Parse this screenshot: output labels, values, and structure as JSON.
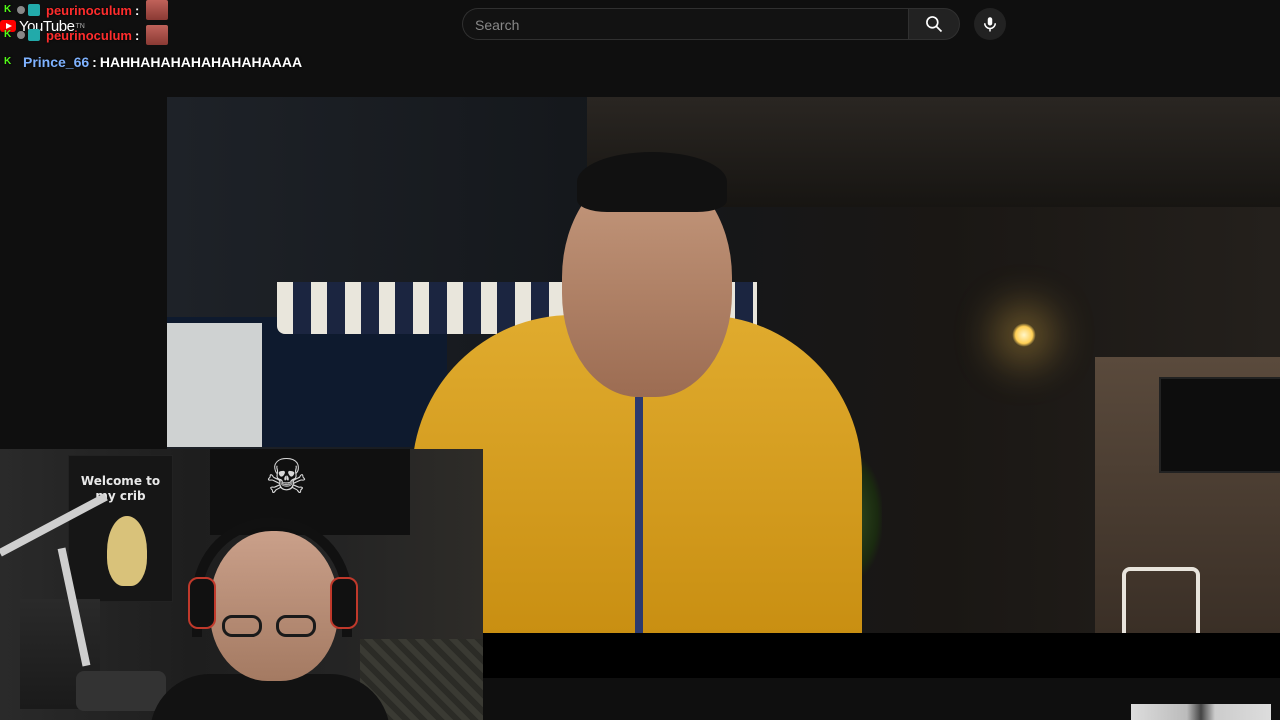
{
  "header": {
    "logo_text": "YouTube",
    "logo_superscript": "TN",
    "search_placeholder": "Search",
    "search_icon": "search-icon",
    "mic_icon": "mic-icon"
  },
  "chat": {
    "messages": [
      {
        "user": "peurinoculum",
        "separator": ":",
        "text": "",
        "user_color": "#ff2d2d",
        "emote": true
      },
      {
        "user": "peurinoculum",
        "separator": ":",
        "text": "",
        "user_color": "#ff2d2d",
        "emote": true
      },
      {
        "user": "Prince_66",
        "separator": ":",
        "text": "HAHHAHAHAHAHAHAHAAAA",
        "user_color": "#7fb2ff",
        "emote": false
      }
    ],
    "badge_glyph": "K",
    "badge_color": "#53fc18"
  },
  "webcam": {
    "banner_text": "Welcome to my crib",
    "skull_glyph": "☠"
  },
  "colors": {
    "background": "#0f0f0f",
    "accent": "#ff0000",
    "jacket": "#e0ab2e"
  }
}
